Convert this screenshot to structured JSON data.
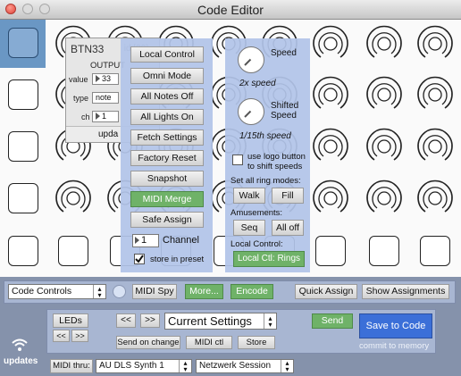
{
  "window": {
    "title": "Code Editor"
  },
  "popup": {
    "name": "BTN33",
    "id": "id:[32]",
    "section": "OUTPUT",
    "value_label": "value",
    "value": "33",
    "type_label": "type",
    "type": "note",
    "ch_label": "ch",
    "ch": "1",
    "footer": "upda"
  },
  "panelA": {
    "buttons": [
      "Local Control",
      "Omni Mode",
      "All Notes Off",
      "All Lights On",
      "Fetch Settings",
      "Factory Reset",
      "Snapshot",
      "MIDI Merge",
      "Safe Assign"
    ],
    "channel_value": "1",
    "channel_label": "Channel",
    "store_label": "store in preset"
  },
  "panelB": {
    "speed_label": "Speed",
    "speed_value": "2x speed",
    "shifted_label": "Shifted Speed",
    "shifted_value": "1/15th speed",
    "logo_label": "use logo button to shift speeds",
    "ring_modes_label": "Set all ring modes:",
    "walk": "Walk",
    "fill": "Fill",
    "amusements_label": "Amusements:",
    "seq": "Seq",
    "all_off": "All off",
    "local_control_label": "Local Control:",
    "local_ctl_button": "Local Ctl: Rings"
  },
  "toolbar": {
    "mode": "Code Controls",
    "midi_spy": "MIDI Spy",
    "more": "More...",
    "encode": "Encode",
    "quick_assign": "Quick Assign",
    "show_assignments": "Show Assignments"
  },
  "lower": {
    "leds": "LEDs",
    "left": "<<",
    "right": ">>",
    "prev": "<<",
    "next": ">>",
    "settings": "Current Settings",
    "send": "Send",
    "save_to_code": "Save to Code",
    "commit": "commit to memory",
    "send_on_change": "Send on change",
    "midi_ctl": "MIDI ctl",
    "store": "Store"
  },
  "footer": {
    "updates": "updates",
    "midi_thru_label": "MIDI thru:",
    "synth": "AU DLS Synth 1",
    "session": "Netzwerk Session"
  },
  "colors": {
    "accent_green": "#6fb268",
    "panel_blue": "#b2c4e8",
    "selected_blue": "#6a97c4",
    "save_blue": "#3b6fd8"
  },
  "icons": [
    "ring-encoder-icon",
    "pad-square-icon",
    "wifi-icon",
    "checkbox-icon",
    "stepper-icon"
  ]
}
